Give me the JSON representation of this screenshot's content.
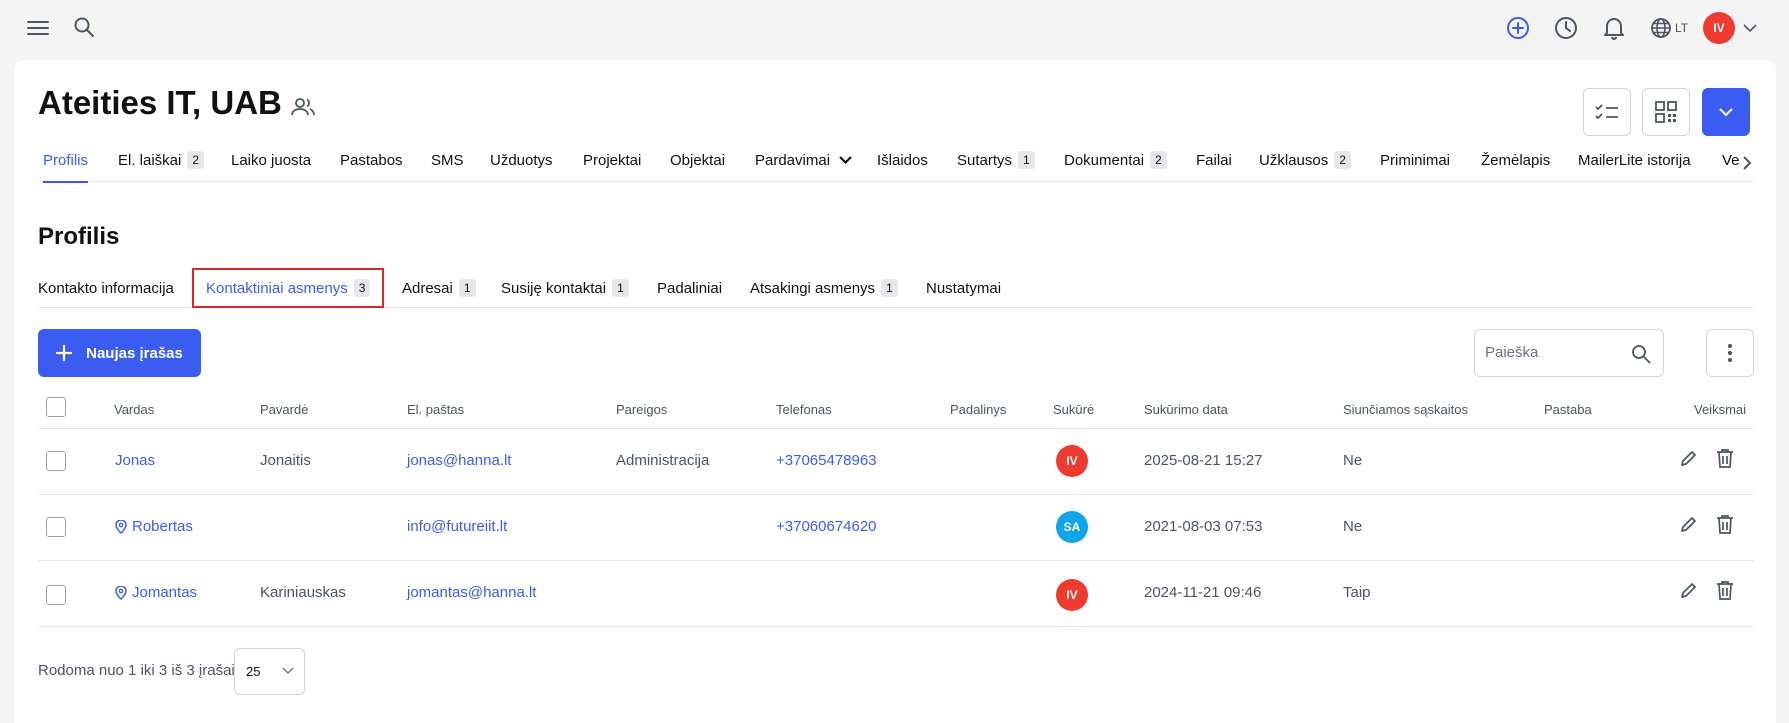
{
  "topbar": {
    "icons": [
      "menu-icon",
      "search-icon",
      "plus-circle-icon",
      "clock-icon",
      "bell-icon",
      "globe-icon",
      "chevron-down-icon"
    ],
    "language": "LT",
    "user_initials": "IV",
    "accent_color": "#3b5cf0",
    "avatar_color": "#ef3b2f"
  },
  "header": {
    "title": "Ateities IT, UAB",
    "title_icon": "users-icon"
  },
  "main_tabs": [
    {
      "label": "Profilis",
      "badge": "",
      "active": true
    },
    {
      "label": "El. laiškai",
      "badge": "2"
    },
    {
      "label": "Laiko juosta",
      "badge": ""
    },
    {
      "label": "Pastabos",
      "badge": ""
    },
    {
      "label": "SMS",
      "badge": ""
    },
    {
      "label": "Užduotys",
      "badge": ""
    },
    {
      "label": "Projektai",
      "badge": ""
    },
    {
      "label": "Objektai",
      "badge": ""
    },
    {
      "label": "Pardavimai",
      "badge": ""
    },
    {
      "label": "Išlaidos",
      "badge": ""
    },
    {
      "label": "Sutartys",
      "badge": "1"
    },
    {
      "label": "Dokumentai",
      "badge": "2"
    },
    {
      "label": "Failai",
      "badge": ""
    },
    {
      "label": "Užklausos",
      "badge": "2"
    },
    {
      "label": "Priminimai",
      "badge": ""
    },
    {
      "label": "Žemėlapis",
      "badge": ""
    },
    {
      "label": "MailerLite istorija",
      "badge": ""
    },
    {
      "label": "Ve",
      "badge": ""
    }
  ],
  "section": {
    "title": "Profilis"
  },
  "sub_tabs": [
    {
      "label": "Kontakto informacija",
      "badge": ""
    },
    {
      "label": "Kontaktiniai asmenys",
      "badge": "3",
      "active": true
    },
    {
      "label": "Adresai",
      "badge": "1"
    },
    {
      "label": "Susiję kontaktai",
      "badge": "1"
    },
    {
      "label": "Padaliniai",
      "badge": ""
    },
    {
      "label": "Atsakingi asmenys",
      "badge": "1"
    },
    {
      "label": "Nustatymai",
      "badge": ""
    }
  ],
  "toolbar": {
    "new_label": "Naujas įrašas",
    "search_placeholder": "Paieška"
  },
  "table": {
    "columns": [
      "Vardas",
      "Pavardė",
      "El. paštas",
      "Pareigos",
      "Telefonas",
      "Padalinys",
      "Sukūrė",
      "Sukūrimo data",
      "Siunčiamos sąskaitos",
      "Pastaba",
      "Veiksmai"
    ],
    "rows": [
      {
        "vardas": "Jonas",
        "pavarde": "Jonaitis",
        "email": "jonas@hanna.lt",
        "pareigos": "Administracija",
        "telefonas": "+37065478963",
        "padalinys": "",
        "sukure": "IV",
        "sukure_color": "#ef3b2f",
        "data": "2025-08-21 15:27",
        "saskaitos": "Ne",
        "pastaba": "",
        "pin": false
      },
      {
        "vardas": "Robertas",
        "pavarde": "",
        "email": "info@futureiit.lt",
        "pareigos": "",
        "telefonas": "+37060674620",
        "padalinys": "",
        "sukure": "SA",
        "sukure_color": "#0ea5e9",
        "data": "2021-08-03 07:53",
        "saskaitos": "Ne",
        "pastaba": "",
        "pin": true
      },
      {
        "vardas": "Jomantas",
        "pavarde": "Kariniauskas",
        "email": "jomantas@hanna.lt",
        "pareigos": "",
        "telefonas": "",
        "padalinys": "",
        "sukure": "IV",
        "sukure_color": "#ef3b2f",
        "data": "2024-11-21 09:46",
        "saskaitos": "Taip",
        "pastaba": "",
        "pin": true
      }
    ]
  },
  "footer": {
    "summary": "Rodoma nuo 1 iki 3 iš 3 įrašai",
    "page_size": "25"
  }
}
